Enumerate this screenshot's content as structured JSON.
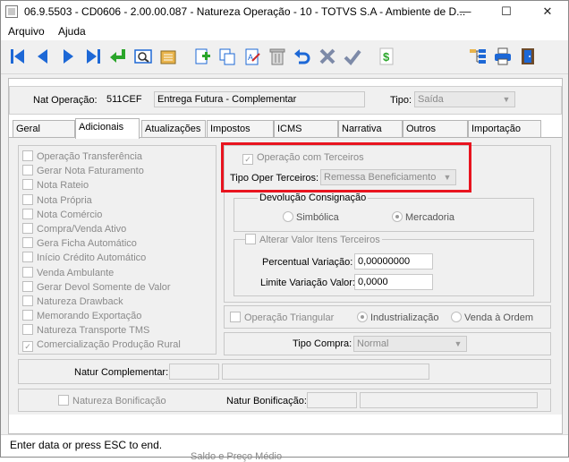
{
  "window": {
    "title": "06.9.5503 - CD0606 - 2.00.00.087 - Natureza Operação - 10 - TOTVS S.A - Ambiente de D...",
    "minimize": "—",
    "restore": "☐",
    "close": "✕"
  },
  "menu": {
    "items": [
      "Arquivo",
      "Ajuda"
    ]
  },
  "toolbar": {
    "icons": [
      "first-record-icon",
      "prev-record-icon",
      "next-record-icon",
      "last-record-icon",
      "goto-icon",
      "search-icon",
      "list-icon",
      "add-icon",
      "copy-icon",
      "edit-icon",
      "delete-icon",
      "undo-icon",
      "cancel-icon",
      "confirm-icon",
      "money-icon",
      "tree-icon",
      "print-icon",
      "exit-icon"
    ],
    "colors": {
      "blue": "#1d68d6",
      "green": "#2aa52a",
      "red": "#cc2a2a",
      "gray": "#7d7d7d"
    }
  },
  "header": {
    "nat_operacao_label": "Nat Operação:",
    "nat_operacao_code": "511CEF",
    "nat_operacao_desc": "Entrega Futura - Complementar",
    "tipo_label": "Tipo:",
    "tipo_value": "Saída"
  },
  "tabs": [
    {
      "label": "Geral"
    },
    {
      "label": "Adicionais"
    },
    {
      "label": "Atualizações"
    },
    {
      "label": "Impostos"
    },
    {
      "label": "ICMS"
    },
    {
      "label": "Narrativa"
    },
    {
      "label": "Outros"
    },
    {
      "label": "Importação"
    }
  ],
  "left_checks": [
    {
      "label": "Operação Transferência",
      "checked": false
    },
    {
      "label": "Gerar Nota Faturamento",
      "checked": false
    },
    {
      "label": "Nota Rateio",
      "checked": false
    },
    {
      "label": "Nota Própria",
      "checked": false
    },
    {
      "label": "Nota Comércio",
      "checked": false
    },
    {
      "label": "Compra/Venda Ativo",
      "checked": false
    },
    {
      "label": "Gera Ficha Automático",
      "checked": false
    },
    {
      "label": "Início Crédito Automático",
      "checked": false
    },
    {
      "label": "Venda Ambulante",
      "checked": false
    },
    {
      "label": "Gerar Devol Somente de Valor",
      "checked": false
    },
    {
      "label": "Natureza Drawback",
      "checked": false
    },
    {
      "label": "Memorando Exportação",
      "checked": false
    },
    {
      "label": "Natureza Transporte TMS",
      "checked": false
    },
    {
      "label": "Comercialização Produção Rural",
      "checked": true
    }
  ],
  "terceiros": {
    "operacao_label": "Operação com Terceiros",
    "operacao_checked": true,
    "tipo_oper_label": "Tipo Oper Terceiros:",
    "tipo_oper_value": "Remessa Beneficiamento",
    "highlight_color": "#e8141f"
  },
  "devolucao": {
    "title": "Devolução Consignação",
    "simbolica": "Simbólica",
    "mercadoria": "Mercadoria",
    "selected": "mercadoria"
  },
  "alterar": {
    "label": "Alterar Valor Itens Terceiros",
    "checked": false,
    "perc_label": "Percentual Variação:",
    "perc_value": "0,00000000",
    "limite_label": "Limite Variação Valor:",
    "limite_value": "0,0000"
  },
  "triangular": {
    "label": "Operação Triangular",
    "checked": false,
    "industrializacao": "Industrialização",
    "venda_ordem": "Venda à Ordem",
    "selected": "industrializacao"
  },
  "tipo_compra": {
    "label": "Tipo Compra:",
    "value": "Normal"
  },
  "natur_complementar": {
    "label": "Natur Complementar:",
    "code": "",
    "desc": ""
  },
  "bonificacao": {
    "check_label": "Natureza Bonificação",
    "checked": false,
    "natur_label": "Natur Bonificação:",
    "code": "",
    "desc": ""
  },
  "status": {
    "text": "Enter data or press ESC to end.",
    "underlying_text": "Saldo e Preço Médio"
  }
}
